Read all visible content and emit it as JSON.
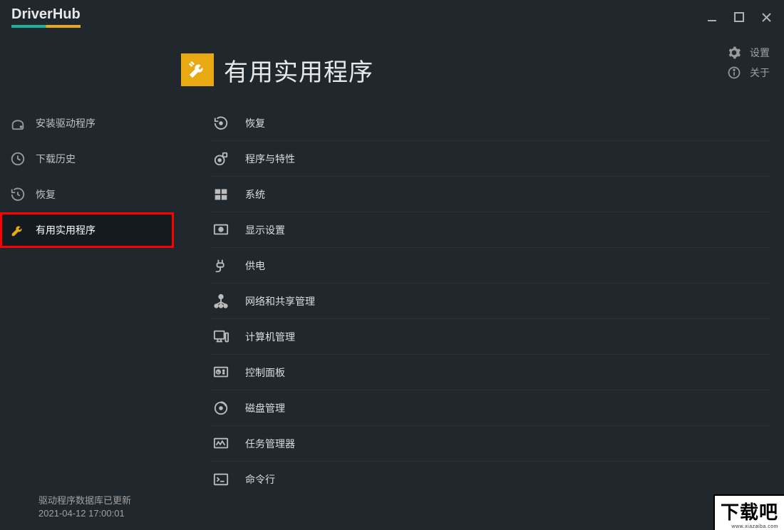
{
  "app_name": "DriverHub",
  "page": {
    "title": "有用实用程序"
  },
  "top_actions": {
    "settings": "设置",
    "about": "关于"
  },
  "sidebar": {
    "items": [
      {
        "label": "安装驱动程序"
      },
      {
        "label": "下载历史"
      },
      {
        "label": "恢复"
      },
      {
        "label": "有用实用程序"
      }
    ]
  },
  "tools": [
    {
      "label": "恢复"
    },
    {
      "label": "程序与特性"
    },
    {
      "label": "系统"
    },
    {
      "label": "显示设置"
    },
    {
      "label": "供电"
    },
    {
      "label": "网络和共享管理"
    },
    {
      "label": "计算机管理"
    },
    {
      "label": "控制面板"
    },
    {
      "label": "磁盘管理"
    },
    {
      "label": "任务管理器"
    },
    {
      "label": "命令行"
    }
  ],
  "footer": {
    "line1": "驱动程序数据库已更新",
    "line2": "2021-04-12 17:00:01"
  },
  "watermark": {
    "text": "下载吧",
    "url": "www.xiazaiba.com"
  }
}
